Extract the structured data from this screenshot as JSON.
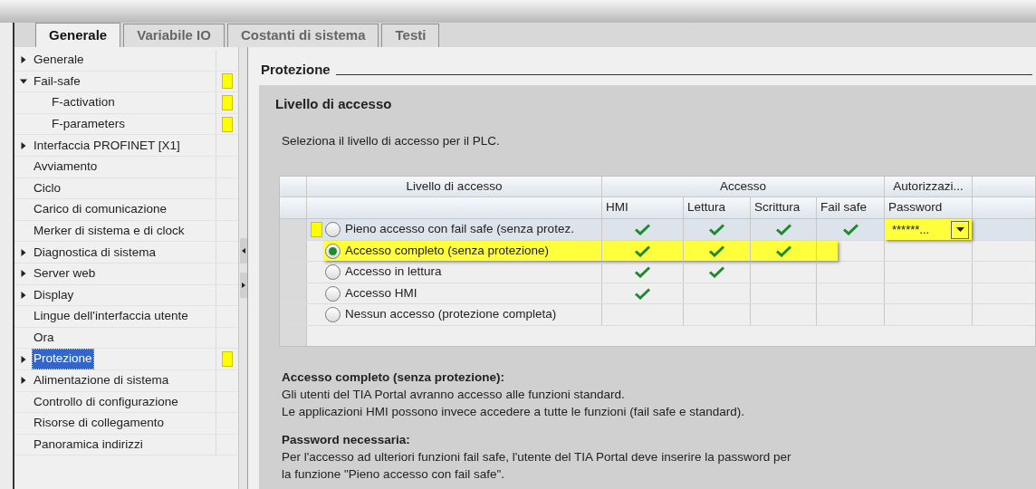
{
  "tabs": [
    {
      "label": "Generale",
      "selected": true
    },
    {
      "label": "Variabile IO",
      "selected": false
    },
    {
      "label": "Costanti di sistema",
      "selected": false
    },
    {
      "label": "Testi",
      "selected": false
    }
  ],
  "sidebar": {
    "items": [
      {
        "label": "Generale",
        "kind": "folder",
        "expanded": false,
        "selected": false,
        "flagged": false
      },
      {
        "label": "Fail-safe",
        "kind": "folder",
        "expanded": true,
        "selected": false,
        "flagged": true,
        "children": [
          {
            "label": "F-activation",
            "kind": "leaf",
            "selected": false,
            "flagged": true
          },
          {
            "label": "F-parameters",
            "kind": "leaf",
            "selected": false,
            "flagged": true
          }
        ]
      },
      {
        "label": "Interfaccia PROFINET [X1]",
        "kind": "folder",
        "expanded": false,
        "selected": false,
        "flagged": false
      },
      {
        "label": "Avviamento",
        "kind": "leaf",
        "selected": false,
        "flagged": false
      },
      {
        "label": "Ciclo",
        "kind": "leaf",
        "selected": false,
        "flagged": false
      },
      {
        "label": "Carico di comunicazione",
        "kind": "leaf",
        "selected": false,
        "flagged": false
      },
      {
        "label": "Merker di sistema e di clock",
        "kind": "leaf",
        "selected": false,
        "flagged": false
      },
      {
        "label": "Diagnostica di sistema",
        "kind": "folder",
        "expanded": false,
        "selected": false,
        "flagged": false
      },
      {
        "label": "Server web",
        "kind": "folder",
        "expanded": false,
        "selected": false,
        "flagged": false
      },
      {
        "label": "Display",
        "kind": "folder",
        "expanded": false,
        "selected": false,
        "flagged": false
      },
      {
        "label": "Lingue dell'interfaccia utente",
        "kind": "leaf",
        "selected": false,
        "flagged": false
      },
      {
        "label": "Ora",
        "kind": "leaf",
        "selected": false,
        "flagged": false
      },
      {
        "label": "Protezione",
        "kind": "folder",
        "expanded": false,
        "selected": true,
        "flagged": true
      },
      {
        "label": "Alimentazione di sistema",
        "kind": "folder",
        "expanded": false,
        "selected": false,
        "flagged": false
      },
      {
        "label": "Controllo di configurazione",
        "kind": "leaf",
        "selected": false,
        "flagged": false
      },
      {
        "label": "Risorse di collegamento",
        "kind": "leaf",
        "selected": false,
        "flagged": false
      },
      {
        "label": "Panoramica indirizzi",
        "kind": "leaf",
        "selected": false,
        "flagged": false
      }
    ]
  },
  "section_title": "Protezione",
  "group": {
    "title": "Livello di accesso",
    "intro": "Seleziona il livello di accesso per il PLC.",
    "table": {
      "group_headers": [
        "Livello di accesso",
        "Accesso",
        "Autorizzazi..."
      ],
      "columns": [
        "HMI",
        "Lettura",
        "Scrittura",
        "Fail safe",
        "Password"
      ],
      "rows": [
        {
          "label": "Pieno accesso con fail safe (senza protez.",
          "selected": false,
          "flagged": true,
          "current": true,
          "highlighted": false,
          "checks": [
            true,
            true,
            true,
            true
          ],
          "password": "******...",
          "password_highlighted": true
        },
        {
          "label": "Accesso completo (senza protezione)",
          "selected": true,
          "flagged": false,
          "current": false,
          "highlighted": true,
          "checks": [
            true,
            true,
            true,
            false
          ]
        },
        {
          "label": "Accesso in lettura",
          "selected": false,
          "flagged": false,
          "current": false,
          "highlighted": false,
          "checks": [
            true,
            true,
            false,
            false
          ]
        },
        {
          "label": "Accesso HMI",
          "selected": false,
          "flagged": false,
          "current": false,
          "highlighted": false,
          "checks": [
            true,
            false,
            false,
            false
          ]
        },
        {
          "label": "Nessun accesso (protezione completa)",
          "selected": false,
          "flagged": false,
          "current": false,
          "highlighted": false,
          "checks": [
            false,
            false,
            false,
            false
          ]
        }
      ]
    },
    "notes": [
      {
        "heading": "Accesso completo (senza protezione):",
        "lines": [
          "Gli utenti del TIA Portal avranno accesso alle funzioni standard.",
          "Le applicazioni HMI possono invece accedere a tutte le funzioni (fail safe e standard)."
        ]
      },
      {
        "heading": "Password necessaria:",
        "lines": [
          "Per l'accesso ad ulteriori funzioni fail safe, l'utente del TIA Portal deve inserire la password per",
          "la funzione \"Pieno accesso con fail safe\"."
        ]
      }
    ]
  }
}
